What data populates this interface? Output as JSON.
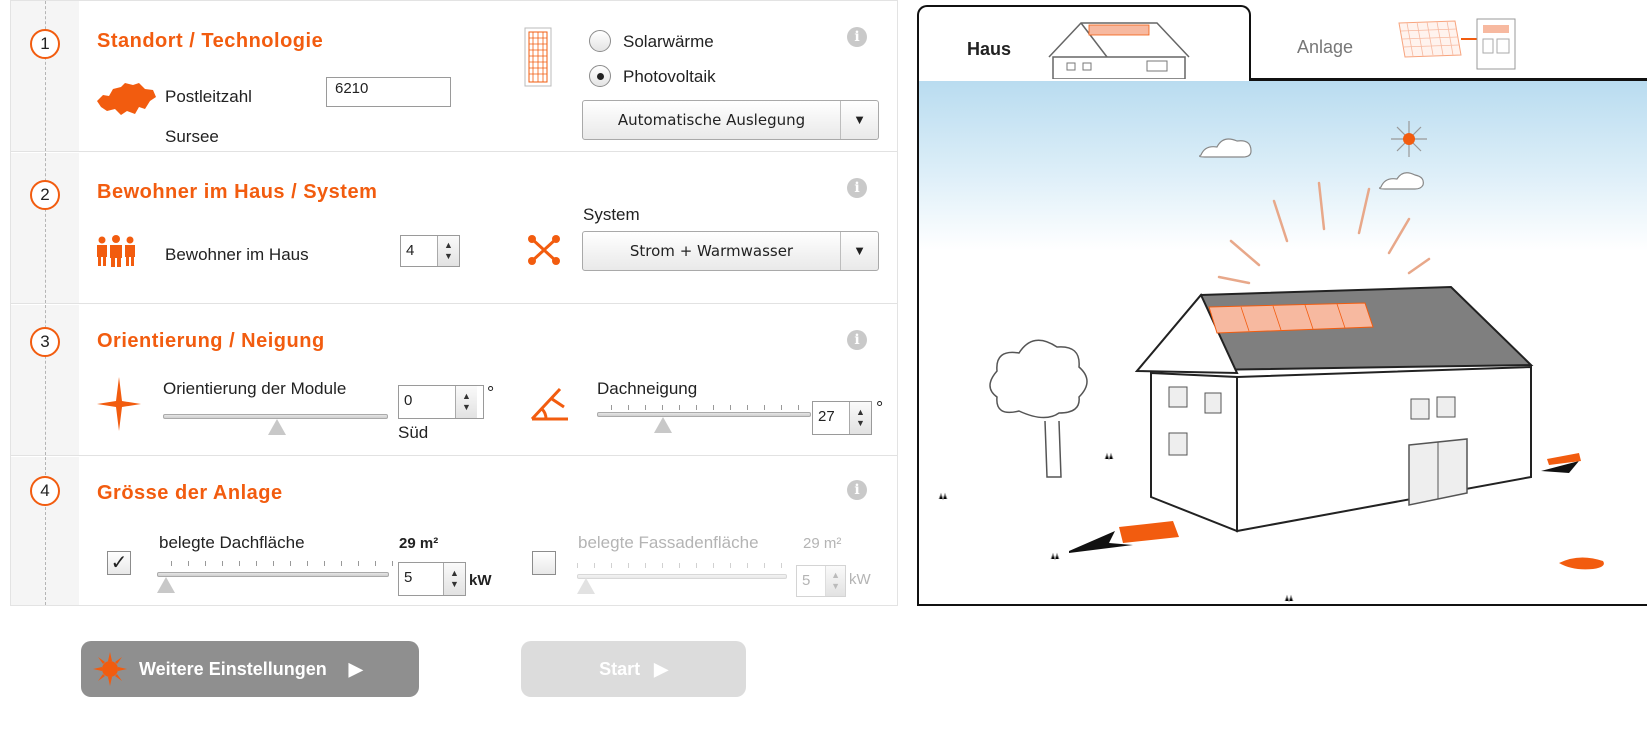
{
  "sections": [
    {
      "number": "1",
      "title": "Standort / Technologie"
    },
    {
      "number": "2",
      "title": "Bewohner im Haus / System"
    },
    {
      "number": "3",
      "title": "Orientierung / Neigung"
    },
    {
      "number": "4",
      "title": "Grösse der Anlage"
    }
  ],
  "standort": {
    "postleitzahl_label": "Postleitzahl",
    "postleitzahl_value": "6210",
    "ort": "Sursee",
    "tech_options": [
      "Solarwärme",
      "Photovoltaik"
    ],
    "tech_selected": "Photovoltaik",
    "auslegung": "Automatische Auslegung"
  },
  "bewohner": {
    "label": "Bewohner im Haus",
    "value": "4",
    "system_label": "System",
    "system_value": "Strom + Warmwasser"
  },
  "orientierung": {
    "label": "Orientierung der Module",
    "value": "0",
    "unit": "°",
    "direction": "Süd",
    "slider_level": 0.5,
    "dach_label": "Dachneigung",
    "dach_value": "27",
    "dach_unit": "°",
    "dach_slider_level": 0.3
  },
  "groesse": {
    "dach_checked": true,
    "dach_label": "belegte Dachfläche",
    "dach_area": "29 m²",
    "dach_kw": "5",
    "kw_unit": "kW",
    "fassade_checked": false,
    "fassade_label": "belegte Fassadenfläche",
    "fassade_area": "29 m²",
    "fassade_kw": "5",
    "fassade_unit": "kW"
  },
  "buttons": {
    "weitere": "Weitere Einstellungen",
    "start": "Start"
  },
  "tabs": {
    "haus": "Haus",
    "anlage": "Anlage",
    "active": "Haus"
  },
  "colors": {
    "accent": "#f25c0f",
    "button_dark": "#8f8f8f",
    "button_disabled": "#dcdcdc"
  }
}
